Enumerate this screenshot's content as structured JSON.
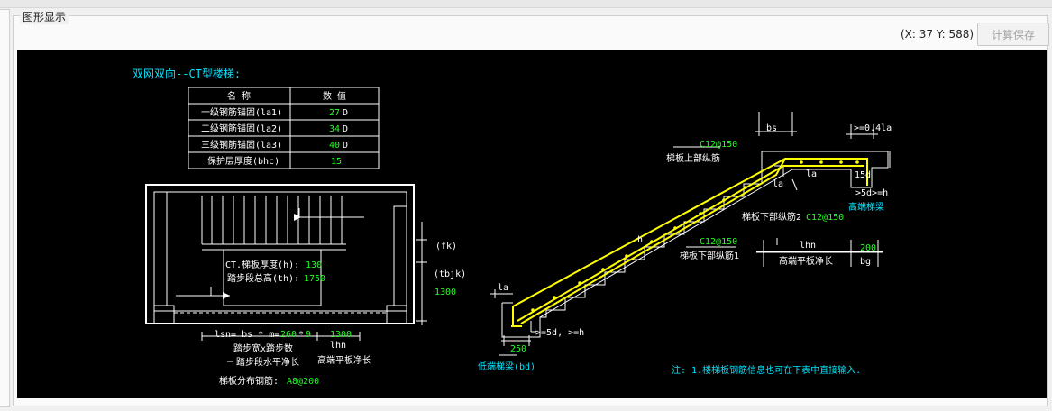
{
  "panel": {
    "title": "图形显示"
  },
  "toolbar": {
    "coords": "(X: 37 Y: 588)",
    "save_label": "计算保存"
  },
  "drawing": {
    "title": "双网双向--CT型楼梯:",
    "table": {
      "headers": [
        "名  称",
        "数  值"
      ],
      "rows": [
        {
          "name": "一级钢筋锚固(la1)",
          "value": "27",
          "unit": "D"
        },
        {
          "name": "二级钢筋锚固(la2)",
          "value": "34",
          "unit": "D"
        },
        {
          "name": "三级钢筋锚固(la3)",
          "value": "40",
          "unit": "D"
        },
        {
          "name": "保护层厚度(bhc)",
          "value": "15",
          "unit": ""
        }
      ]
    },
    "plan": {
      "slab_thickness_label": "CT.梯板厚度(h):",
      "slab_thickness_value": "130",
      "step_height_label": "踏步段总高(th):",
      "step_height_value": "1750",
      "fk": "(fk)",
      "tbjk": "(tbjk)",
      "width_value": "1300",
      "lsn_label": "lsn= bs * m=",
      "bs_value": "260",
      "times": "*",
      "m_value": "9",
      "lhn_value": "1300",
      "lhn_label": "lhn",
      "step_legend": "踏步宽x踏步数",
      "horiz_len_legend": "踏步段水平净长",
      "landing_legend": "高端平板净长",
      "distribution_label": "梯板分布钢筋:",
      "distribution_value": "A8@200"
    },
    "section": {
      "bs": "bs",
      "top_anchor": ">=0.4la",
      "top_rebar_spec": "C12@150",
      "top_rebar_label": "梯板上部纵筋",
      "la_top": "la",
      "la_mid": "la",
      "d15": "15d",
      "d5_right": ">5d>=h",
      "lower_rebar2_label": "梯板下部纵筋2",
      "lower_rebar2_spec": "C12@150",
      "high_beam": "高端梯梁",
      "h_label": "h",
      "lower_rebar1_spec": "C12@150",
      "lower_rebar1_label": "梯板下部纵筋1",
      "lhn": "lhn",
      "lhn_value": "200",
      "high_landing": "高端平板净长",
      "bg": "bg",
      "la_left": "la",
      "d5_left": ">=5d, >=h",
      "beam_width": "250",
      "low_beam": "低端梯梁(bd)",
      "note": "注: 1.楼梯板钢筋信息也可在下表中直接输入."
    },
    "colors": {
      "cyan": "#00e5ff",
      "green": "#22ff22",
      "yellow": "#ffff00",
      "white": "#ffffff"
    }
  }
}
